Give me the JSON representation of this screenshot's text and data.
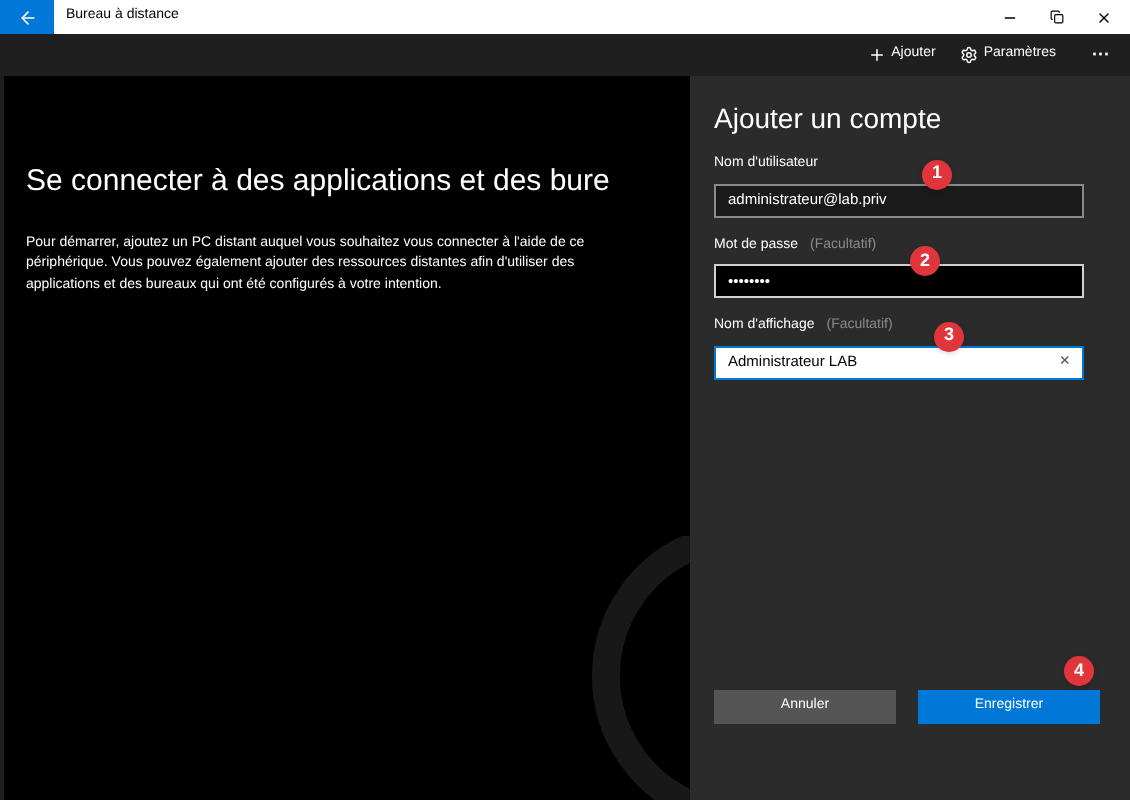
{
  "window": {
    "title": "Bureau à distance"
  },
  "toolbar": {
    "items": [
      {
        "kind": "add",
        "label": "Ajouter"
      },
      {
        "kind": "settings",
        "label": "Paramètres"
      },
      {
        "kind": "more",
        "label": "···"
      }
    ]
  },
  "main": {
    "heading": "Se connecter à des applications et des bure",
    "body": "Pour démarrer, ajoutez un PC distant auquel vous souhaitez vous connecter à l'aide de ce périphérique. Vous pouvez également ajouter des ressources distantes afin d'utiliser des applications et des bureaux qui ont été configurés à votre intention."
  },
  "panel": {
    "title": "Ajouter un compte",
    "fields": [
      {
        "kind": "text",
        "label": "Nom d'utilisateur",
        "value": "administrateur@lab.priv",
        "marker": "1"
      },
      {
        "kind": "password",
        "label": "Mot de passe",
        "hint": "(Facultatif)",
        "value": "••••••••",
        "marker": "2"
      },
      {
        "kind": "focused",
        "label": "Nom d'affichage",
        "hint": "(Facultatif)",
        "value": "Administrateur LAB",
        "clear": "×",
        "marker": "3"
      }
    ],
    "buttons": [
      {
        "kind": "secondary",
        "label": "Annuler"
      },
      {
        "kind": "primary",
        "label": "Enregistrer",
        "marker": "4"
      }
    ]
  }
}
